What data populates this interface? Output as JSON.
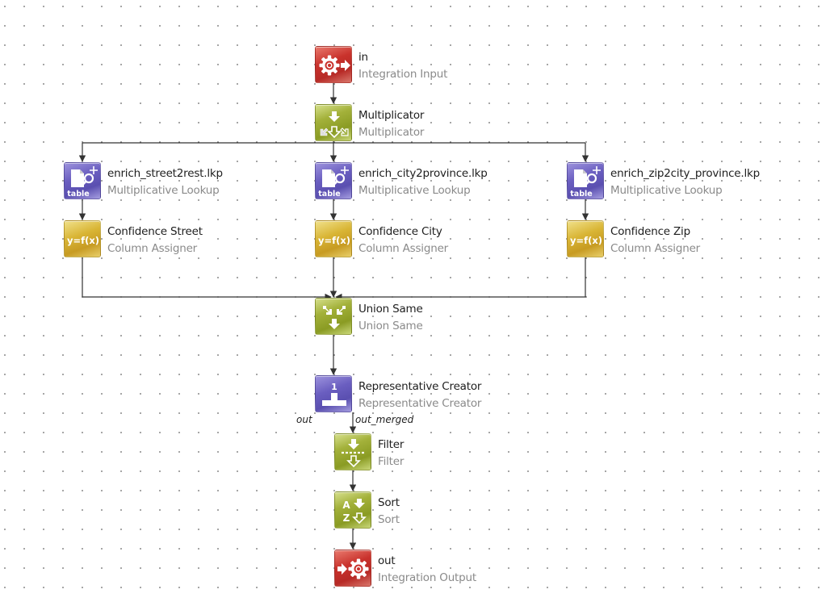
{
  "diagram": {
    "nodes": {
      "in": {
        "name": "in",
        "type": "Integration Input",
        "icon": "gear-arrow-out-icon"
      },
      "multiplicator": {
        "name": "Multiplicator",
        "type": "Multiplicator",
        "icon": "split-arrows-icon"
      },
      "lookup_street": {
        "name": "enrich_street2rest.lkp",
        "type": "Multiplicative Lookup",
        "icon": "table-lookup-icon",
        "icon_text": "table"
      },
      "lookup_city": {
        "name": "enrich_city2province.lkp",
        "type": "Multiplicative Lookup",
        "icon": "table-lookup-icon",
        "icon_text": "table"
      },
      "lookup_zip": {
        "name": "enrich_zip2city_province.lkp",
        "type": "Multiplicative Lookup",
        "icon": "table-lookup-icon",
        "icon_text": "table"
      },
      "conf_street": {
        "name": "Confidence Street",
        "type": "Column Assigner",
        "icon": "function-icon",
        "icon_text": "y=f(x)"
      },
      "conf_city": {
        "name": "Confidence City",
        "type": "Column Assigner",
        "icon": "function-icon",
        "icon_text": "y=f(x)"
      },
      "conf_zip": {
        "name": "Confidence Zip",
        "type": "Column Assigner",
        "icon": "function-icon",
        "icon_text": "y=f(x)"
      },
      "union": {
        "name": "Union Same",
        "type": "Union Same",
        "icon": "merge-arrows-icon"
      },
      "rep": {
        "name": "Representative Creator",
        "type": "Representative Creator",
        "icon": "podium-icon",
        "icon_text": "1"
      },
      "filter": {
        "name": "Filter",
        "type": "Filter",
        "icon": "filter-icon"
      },
      "sort": {
        "name": "Sort",
        "type": "Sort",
        "icon": "sort-az-icon",
        "icon_text_a": "A",
        "icon_text_z": "Z"
      },
      "out": {
        "name": "out",
        "type": "Integration Output",
        "icon": "arrow-in-gear-icon"
      }
    },
    "ports": {
      "rep_out": "out",
      "rep_out_merged": "out_merged"
    },
    "edges": [
      [
        "in",
        "multiplicator"
      ],
      [
        "multiplicator",
        "lookup_street"
      ],
      [
        "multiplicator",
        "lookup_city"
      ],
      [
        "multiplicator",
        "lookup_zip"
      ],
      [
        "lookup_street",
        "conf_street"
      ],
      [
        "lookup_city",
        "conf_city"
      ],
      [
        "lookup_zip",
        "conf_zip"
      ],
      [
        "conf_street",
        "union"
      ],
      [
        "conf_city",
        "union"
      ],
      [
        "conf_zip",
        "union"
      ],
      [
        "union",
        "rep"
      ],
      [
        "rep.out_merged",
        "filter"
      ],
      [
        "filter",
        "sort"
      ],
      [
        "sort",
        "out"
      ]
    ],
    "colors": {
      "io": "#c0322c",
      "transform": "#96a62c",
      "lookup": "#6356bb",
      "assigner": "#d1a92c",
      "wire": "#333333"
    }
  }
}
